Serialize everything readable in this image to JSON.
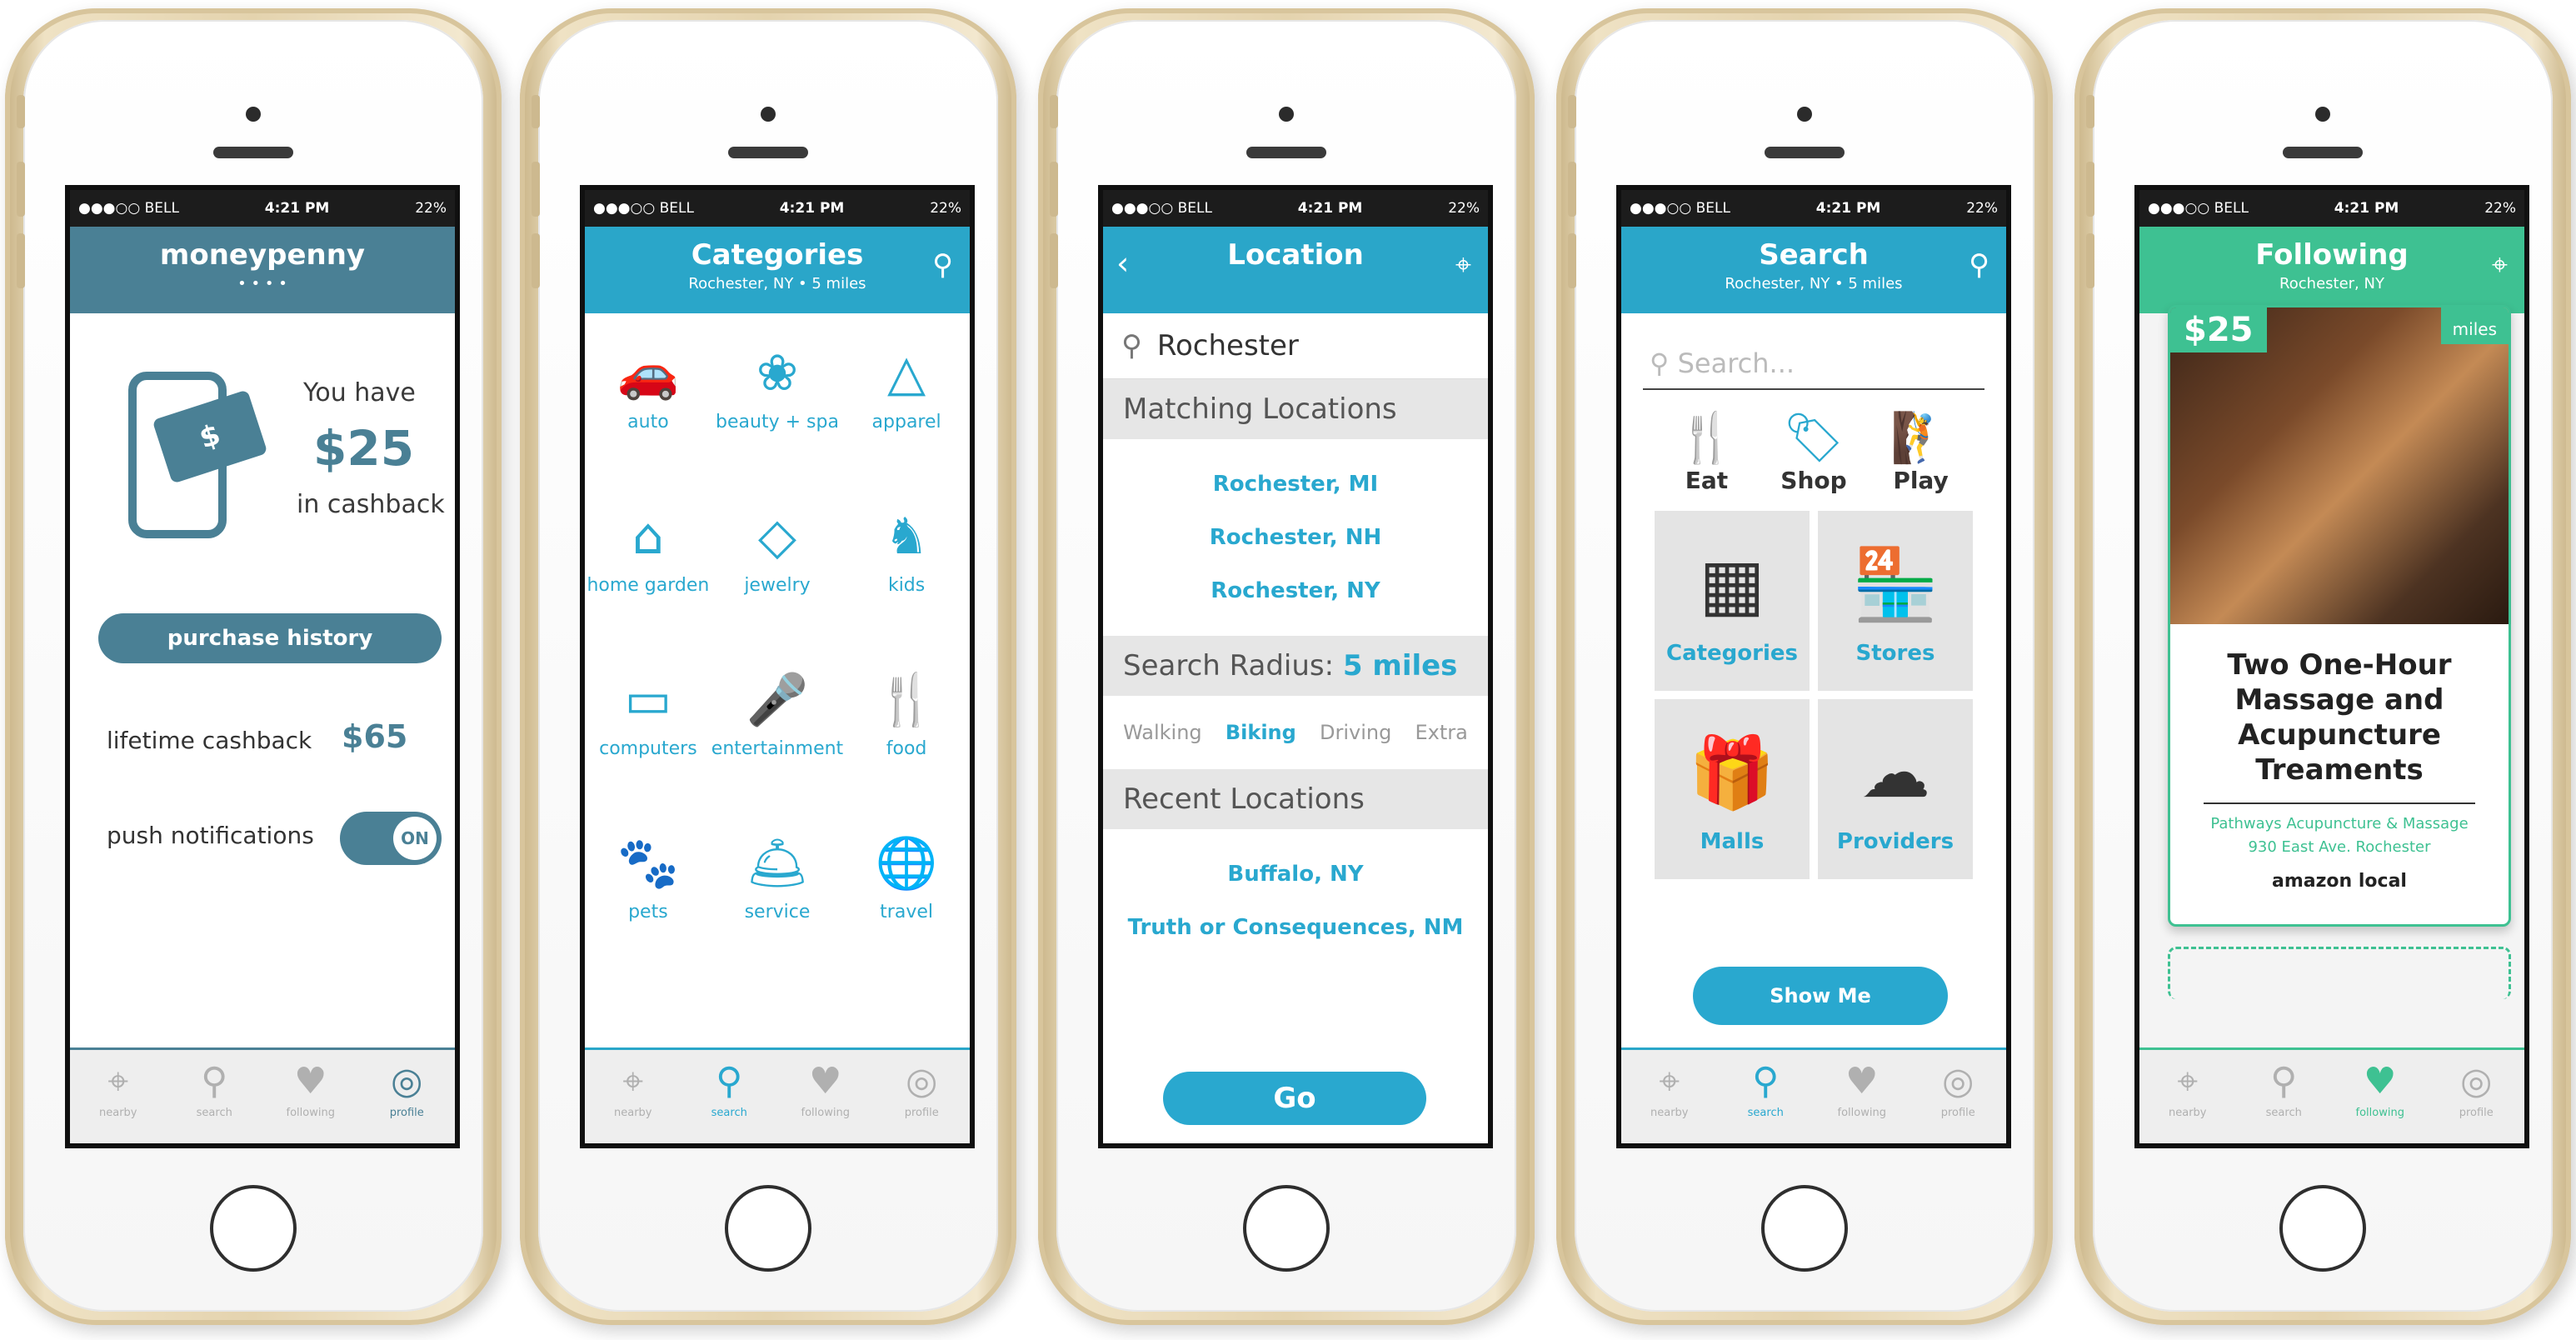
{
  "colors": {
    "teal": "#2aa6c9",
    "slate": "#4a8095",
    "green": "#3ec192"
  },
  "status": {
    "carrier": "●●●○○ BELL",
    "time": "4:21 PM",
    "battery": "22%"
  },
  "tabs": {
    "nearby": "nearby",
    "search": "search",
    "following": "following",
    "profile": "profile"
  },
  "screen1": {
    "title": "moneypenny",
    "dots": "• • • •",
    "you_have": "You have",
    "amount": "$25",
    "in_cashback": "in cashback",
    "purchase_history": "purchase history",
    "lifetime_label": "lifetime cashback",
    "lifetime_value": "$65",
    "push_label": "push notifications",
    "toggle_state": "ON"
  },
  "screen2": {
    "title": "Categories",
    "subtitle": "Rochester, NY • 5 miles",
    "categories": [
      "auto",
      "beauty + spa",
      "apparel",
      "home garden",
      "jewelry",
      "kids",
      "computers",
      "entertainment",
      "food",
      "pets",
      "service",
      "travel"
    ]
  },
  "screen3": {
    "title": "Location",
    "query": "Rochester",
    "matching_header": "Matching Locations",
    "matches": [
      "Rochester, MI",
      "Rochester, NH",
      "Rochester, NY"
    ],
    "radius_label": "Search Radius:",
    "radius_value": "5 miles",
    "modes": [
      "Walking",
      "Biking",
      "Driving",
      "Extra"
    ],
    "recent_header": "Recent Locations",
    "recent": [
      "Buffalo, NY",
      "Truth or Consequences, NM"
    ],
    "go": "Go"
  },
  "screen4": {
    "title": "Search",
    "subtitle": "Rochester, NY • 5 miles",
    "placeholder": "Search...",
    "quick": [
      "Eat",
      "Shop",
      "Play"
    ],
    "tiles": [
      "Categories",
      "Stores",
      "Malls",
      "Providers"
    ],
    "show_me": "Show Me"
  },
  "screen5": {
    "title": "Following",
    "subtitle": "Rochester, NY",
    "price": "$25",
    "distance": "miles",
    "deal_title": "Two One-Hour Massage and Acupuncture Treaments",
    "vendor": "Pathways Acupuncture & Massage",
    "address": "930 East Ave. Rochester",
    "brand": "amazon local"
  }
}
